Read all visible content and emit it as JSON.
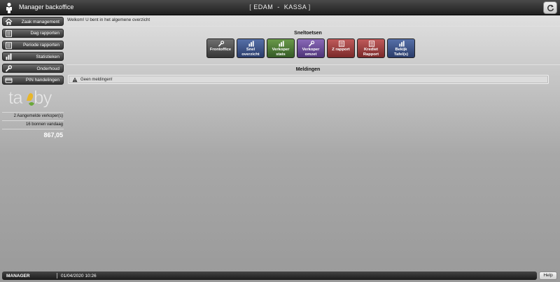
{
  "header": {
    "app_title": "Manager backoffice",
    "location": "EDAM  -  KASSA",
    "bracket_open": "[",
    "bracket_close": "]"
  },
  "sidebar": {
    "items": [
      {
        "label": "Zaak management",
        "icon": "home-icon"
      },
      {
        "label": "Dag rapporten",
        "icon": "report-icon"
      },
      {
        "label": "Periode rapporten",
        "icon": "report-icon"
      },
      {
        "label": "Statistieken",
        "icon": "bar-chart-icon"
      },
      {
        "label": "Onderhoud",
        "icon": "wrench-icon"
      },
      {
        "label": "PIN handelingen",
        "icon": "card-icon"
      }
    ],
    "logo_text": "tabby",
    "stats": {
      "logged_in": "2 Aangemelde verkoper(s)",
      "receipts": "16 bonnen vandaag",
      "total": "867,05"
    }
  },
  "main": {
    "welcome": "Welkom! U bent in het algemene overzicht",
    "shortcuts_title": "Sneltoetsen",
    "shortcuts": [
      {
        "line1": "Frontoffice",
        "line2": "",
        "icon": "wrench-icon",
        "color": "#555555"
      },
      {
        "line1": "Snel",
        "line2": "overzicht",
        "icon": "bar-chart-icon",
        "color": "#3d5488"
      },
      {
        "line1": "Verkoper",
        "line2": "stats",
        "icon": "bar-chart-icon",
        "color": "#4f7a37"
      },
      {
        "line1": "Verkoper",
        "line2": "omzet",
        "icon": "wrench-icon",
        "color": "#6b4f98"
      },
      {
        "line1": "Z rapport",
        "line2": "",
        "icon": "report-icon",
        "color": "#9c4242"
      },
      {
        "line1": "Krediet",
        "line2": "Rapport",
        "icon": "report-icon",
        "color": "#9c4242"
      },
      {
        "line1": "Bekijk",
        "line2": "Tafel(s)",
        "icon": "bar-chart-icon",
        "color": "#3d5488"
      }
    ],
    "notifications_title": "Meldingen",
    "notification_text": "Geen meldingen!"
  },
  "footer": {
    "user": "MANAGER",
    "datetime": "01/04/2020 10:26",
    "help_label": "Help"
  }
}
